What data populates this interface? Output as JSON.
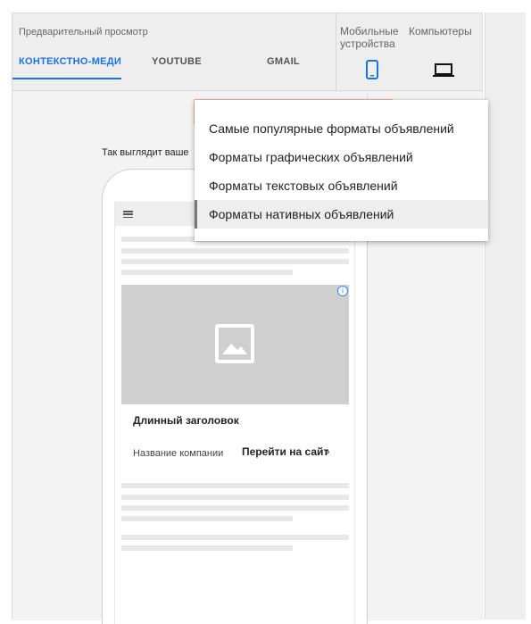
{
  "header": {
    "preview_title": "Предварительный просмотр",
    "tabs": [
      {
        "label": "КОНТЕКСТНО-МЕДИ",
        "active": true
      },
      {
        "label": "YOUTUBE",
        "active": false
      },
      {
        "label": "GMAIL",
        "active": false
      }
    ],
    "devices": {
      "mobile_label": "Мобильные устройства",
      "desktop_label": "Компьютеры",
      "selected": "mobile"
    }
  },
  "preview": {
    "caption": "Так выглядит ваше",
    "ad": {
      "headline": "Длинный заголовок",
      "company": "Название компании",
      "cta": "Перейти на сайт"
    }
  },
  "format_menu": {
    "items": [
      {
        "label": "Самые популярные форматы объявлений",
        "selected": false
      },
      {
        "label": "Форматы графических объявлений",
        "selected": false
      },
      {
        "label": "Форматы текстовых объявлений",
        "selected": false
      },
      {
        "label": "Форматы нативных объявлений",
        "selected": true
      }
    ]
  },
  "colors": {
    "accent": "#1a73e8",
    "panel_bg": "#eeeeee",
    "image_placeholder": "#cfcfcf"
  }
}
